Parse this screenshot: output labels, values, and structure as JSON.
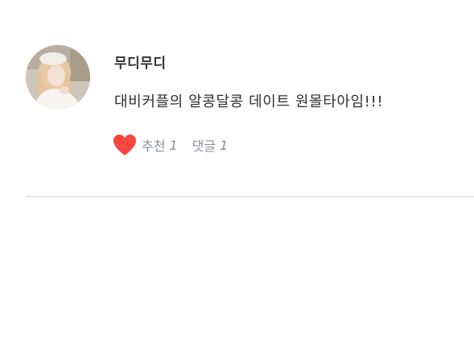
{
  "post": {
    "author": "무디무디",
    "message": "대비커플의 알콩달콩 데이트 원몰타아임!!!",
    "actions": {
      "like_label": "추천",
      "like_count": "1",
      "comment_label": "댓글",
      "comment_count": "1"
    }
  },
  "icons": {
    "like": "heart-icon"
  },
  "colors": {
    "heart": "#f4473f",
    "divider": "#e6eaeb",
    "action_text": "#8a8f94"
  }
}
